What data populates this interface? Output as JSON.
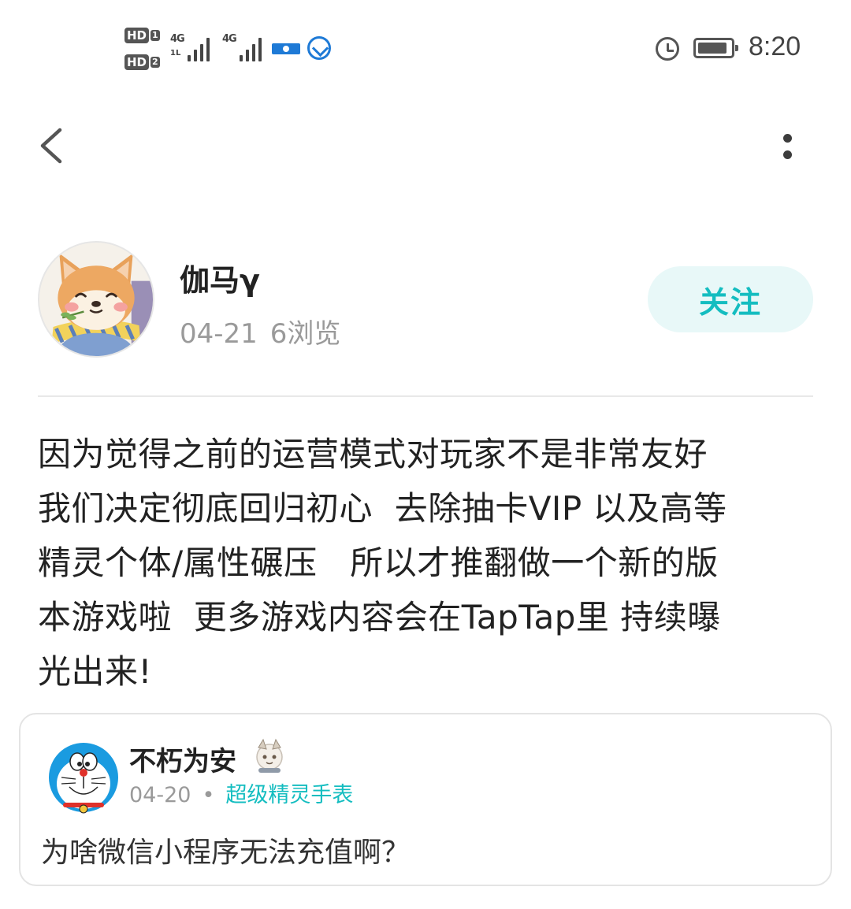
{
  "status_bar": {
    "sim1_label": "HD",
    "sim1_num": "1",
    "sim2_label": "HD",
    "sim2_num": "2",
    "network1": "4G",
    "network1_sub": "1L",
    "network2": "4G",
    "time": "8:20",
    "battery_level": 0.9
  },
  "nav": {
    "back_icon": "chevron-left-icon",
    "more_icon": "more-vertical-icon"
  },
  "author": {
    "name": "伽马γ",
    "date": "04-21",
    "views": "6浏览",
    "follow_label": "关注"
  },
  "post": {
    "body": "因为觉得之前的运营模式对玩家不是非常友好\n我们决定彻底回归初心  去除抽卡VIP 以及高等\n精灵个体/属性碾压   所以才推翻做一个新的版\n本游戏啦  更多游戏内容会在TapTap里 持续曝\n光出来!"
  },
  "comment": {
    "name": "不朽为安",
    "date": "04-20",
    "separator": "•",
    "device": "超级精灵手表",
    "text": "为啥微信小程序无法充值啊？"
  },
  "colors": {
    "accent": "#14bdc0",
    "follow_bg": "#e8f8f8",
    "meta_gray": "#9a9a9a",
    "text_dark": "#222222"
  }
}
